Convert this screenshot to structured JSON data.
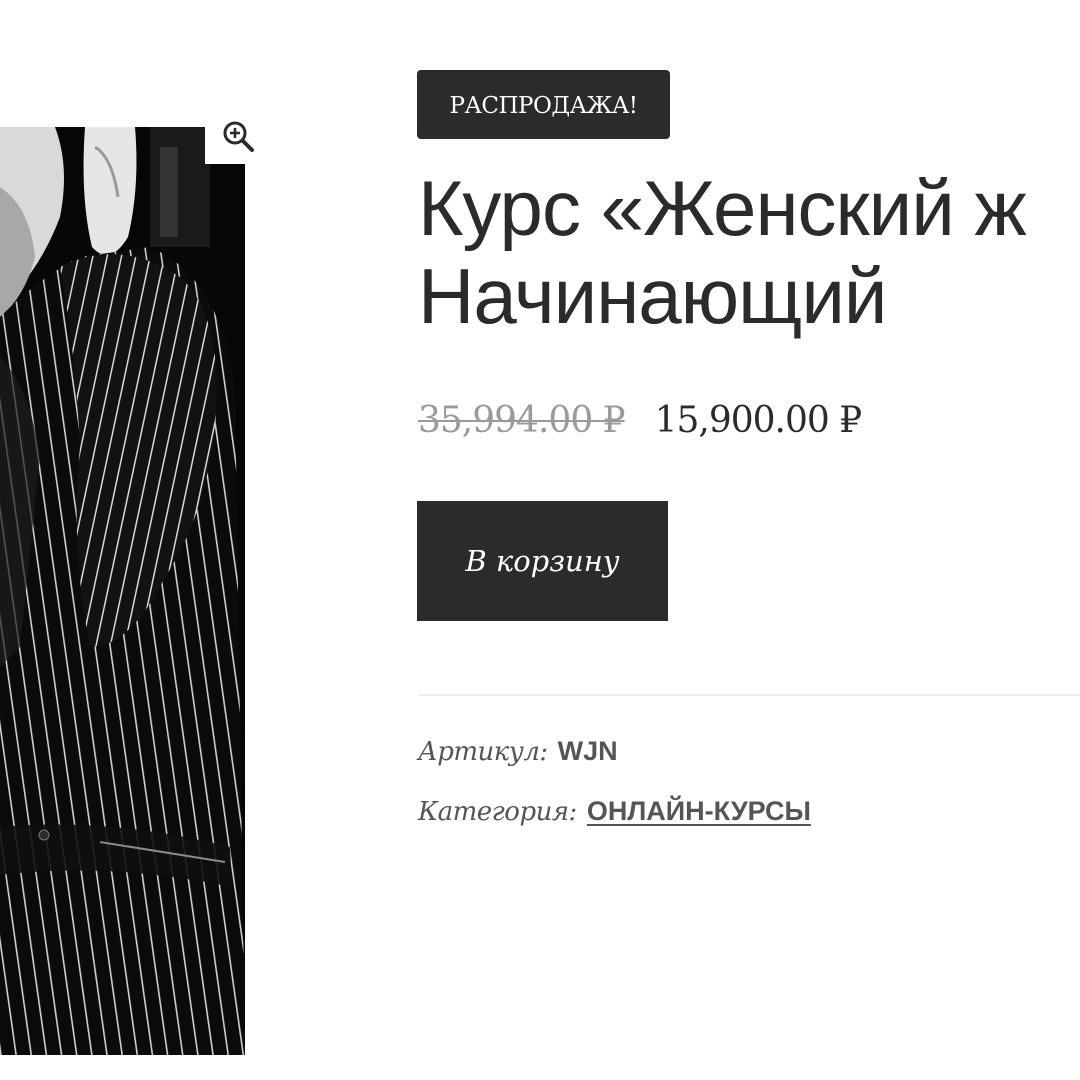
{
  "product": {
    "sale_badge": "РАСПРОДАЖА!",
    "title_line1": "Курс «Женский ж",
    "title_line2": "Начинающий",
    "price_old": "35,994.00 ₽",
    "price_new": "15,900.00 ₽",
    "add_to_cart_label": "В корзину"
  },
  "meta": {
    "sku_label": "Артикул:",
    "sku_value": "WJN",
    "category_label": "Категория:",
    "category_value": "ОНЛАЙН-КУРСЫ"
  },
  "gallery": {
    "zoom_icon": "zoom-in-icon",
    "image_alt": "black-and-white photo of a woman in a pinstripe suit"
  },
  "colors": {
    "dark": "#2b2b2b",
    "old_price": "#9a9a9a",
    "meta_text": "#555555",
    "divider": "#eeeeee"
  }
}
